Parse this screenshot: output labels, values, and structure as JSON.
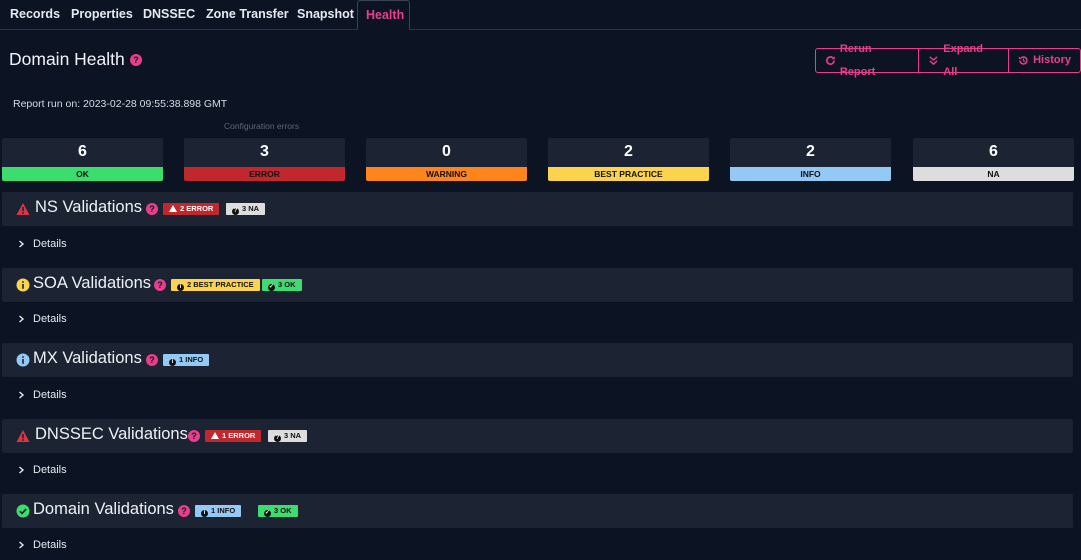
{
  "tabs": [
    "Records",
    "Properties",
    "DNSSEC",
    "Zone Transfer",
    "Snapshot",
    "Health"
  ],
  "active_tab": "Health",
  "page_title": "Domain Health",
  "buttons": {
    "rerun": "Rerun Report",
    "expand": "Expand All",
    "history": "History"
  },
  "report_run": "Report run on: 2023-02-28 09:55:38.898 GMT",
  "tooltip": "Configuration errors",
  "summary": [
    {
      "count": "6",
      "label": "OK",
      "color": "#3ddc6f"
    },
    {
      "count": "3",
      "label": "ERROR",
      "color": "#c0282d"
    },
    {
      "count": "0",
      "label": "WARNING",
      "color": "#fd851b"
    },
    {
      "count": "2",
      "label": "BEST PRACTICE",
      "color": "#fcd34d"
    },
    {
      "count": "2",
      "label": "INFO",
      "color": "#94c9f5"
    },
    {
      "count": "6",
      "label": "NA",
      "color": "#dddddd"
    }
  ],
  "sections": [
    {
      "title": "NS Validations",
      "icon": "warning-triangle-icon",
      "badges": [
        {
          "text": "2 ERROR",
          "kind": "error"
        },
        {
          "text": "3 NA",
          "kind": "na"
        }
      ],
      "details": "Details"
    },
    {
      "title": "SOA Validations",
      "icon": "info-circle-yellow-icon",
      "badges": [
        {
          "text": "2 BEST PRACTICE",
          "kind": "best"
        },
        {
          "text": "3 OK",
          "kind": "ok"
        }
      ],
      "details": "Details"
    },
    {
      "title": "MX Validations",
      "icon": "info-circle-blue-icon",
      "badges": [
        {
          "text": "1 INFO",
          "kind": "info"
        }
      ],
      "details": "Details"
    },
    {
      "title": "DNSSEC Validations",
      "icon": "warning-triangle-icon",
      "badges": [
        {
          "text": "1 ERROR",
          "kind": "error"
        },
        {
          "text": "3 NA",
          "kind": "na"
        }
      ],
      "details": "Details"
    },
    {
      "title": "Domain Validations",
      "icon": "check-circle-icon",
      "badges": [
        {
          "text": "1 INFO",
          "kind": "info"
        },
        {
          "text": "3 OK",
          "kind": "ok"
        }
      ],
      "details": "Details"
    }
  ]
}
